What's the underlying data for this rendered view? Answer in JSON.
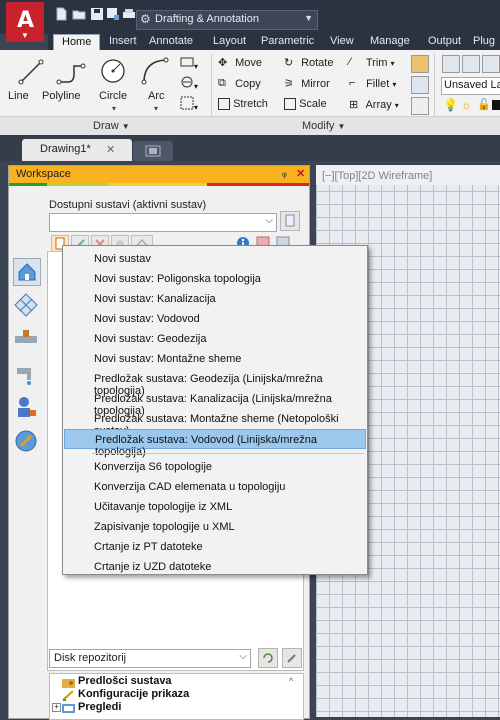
{
  "titlebar": {
    "workspace_select": "Drafting & Annotation"
  },
  "ribbon": {
    "tabs": [
      "Home",
      "Insert",
      "Annotate",
      "Layout",
      "Parametric",
      "View",
      "Manage",
      "Output",
      "Plug"
    ],
    "draw_tools": {
      "line": "Line",
      "polyline": "Polyline",
      "circle": "Circle",
      "arc": "Arc"
    },
    "modify_tools": {
      "move": "Move",
      "rotate": "Rotate",
      "trim": "Trim",
      "copy": "Copy",
      "mirror": "Mirror",
      "fillet": "Fillet",
      "stretch": "Stretch",
      "scale": "Scale",
      "array": "Array"
    },
    "layer_state": "Unsaved Lay",
    "panel_titles": {
      "draw": "Draw",
      "modify": "Modify"
    }
  },
  "doc_tabs": {
    "active": "Drawing1*"
  },
  "workspace_panel": {
    "title": "Workspace",
    "systems_label": "Dostupni sustavi (aktivni sustav)",
    "systems_value": "",
    "repository_value": "Disk repozitorij",
    "tree": [
      "Predlošci sustava",
      "Konfiguracije prikaza",
      "Pregledi"
    ]
  },
  "viewport": {
    "label": "[−][Top][2D Wireframe]"
  },
  "menu": {
    "items": [
      "Novi sustav",
      "Novi sustav: Poligonska topologija",
      "Novi sustav: Kanalizacija",
      "Novi sustav: Vodovod",
      "Novi sustav: Geodezija",
      "Novi sustav: Montažne sheme",
      "Predložak sustava: Geodezija (Linijska/mrežna topologija)",
      "Predložak sustava: Kanalizacija (Linijska/mrežna topologija)",
      "Predložak sustava: Montažne sheme (Netopološki sustav)",
      "Predložak sustava: Vodovod (Linijska/mrežna topologija)",
      "Konverzija S6 topologije",
      "Konverzija CAD elemenata u topologiju",
      "Učitavanje topologije iz XML",
      "Zapisivanje topologije u XML",
      "Crtanje iz PT datoteke",
      "Crtanje iz UZD datoteke"
    ],
    "highlighted": "Predložak sustava: Vodovod (Linijska/mrežna topologija)"
  },
  "colors": {
    "accent_red": "#c8232c",
    "workspace_header": "#f9b321",
    "menu_highlight": "#9cc8ee",
    "titlebar": "#2b3340"
  }
}
